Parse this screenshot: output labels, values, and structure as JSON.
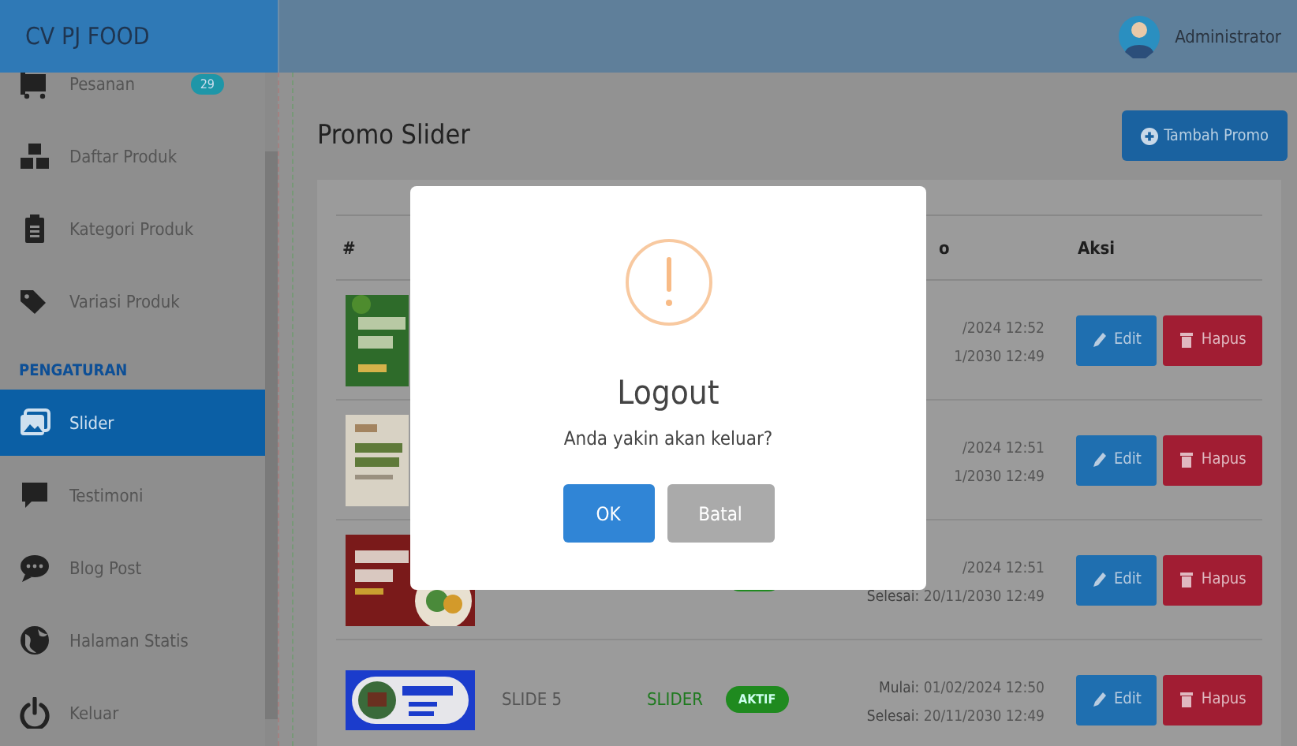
{
  "header": {
    "brand": "CV PJ FOOD",
    "user": "Administrator"
  },
  "sidebar": {
    "items": [
      {
        "kind": "link",
        "label": "Pesanan",
        "badge": "29",
        "selected": false
      },
      {
        "kind": "link",
        "label": "Daftar Produk",
        "selected": false
      },
      {
        "kind": "link",
        "label": "Kategori Produk",
        "selected": false
      },
      {
        "kind": "link",
        "label": "Variasi Produk",
        "selected": false
      },
      {
        "kind": "section",
        "label": "PENGATURAN"
      },
      {
        "kind": "link",
        "label": "Slider",
        "selected": true
      },
      {
        "kind": "link",
        "label": "Testimoni",
        "selected": false
      },
      {
        "kind": "link",
        "label": "Blog Post",
        "selected": false
      },
      {
        "kind": "link",
        "label": "Halaman Statis",
        "selected": false
      },
      {
        "kind": "link",
        "label": "Keluar",
        "selected": false
      }
    ]
  },
  "page": {
    "title": "Promo Slider",
    "add_button": "Tambah Promo"
  },
  "table": {
    "columns": [
      "#",
      "o",
      "Aksi"
    ],
    "rows": [
      {
        "thumb": {
          "kind": "picture"
        },
        "start": "/2024 12:52",
        "end": "1/2030 12:49",
        "actions": [
          "Edit",
          "Hapus"
        ]
      },
      {
        "thumb": {
          "kind": "picture"
        },
        "start": "/2024 12:51",
        "end": "1/2030 12:49",
        "actions": [
          "Edit",
          "Hapus"
        ]
      },
      {
        "thumb": {
          "kind": "picture"
        },
        "status": {
          "kind": "active"
        },
        "start": "/2024 12:51",
        "end": "**Selesai:** 20/11/2030 12:49",
        "actions": [
          "Edit",
          "Hapus"
        ]
      },
      {
        "thumb": {
          "kind": "picture"
        },
        "name": "SLIDE 5",
        "type": "SLIDER",
        "status": {
          "kind": "active",
          "label": "AKTIF"
        },
        "start": "**Mulai:** 01/02/2024 12:50",
        "end": "**Selesai:** 20/11/2030 12:49",
        "actions": [
          "Edit",
          "Hapus"
        ]
      }
    ]
  },
  "modal": {
    "title": "Logout",
    "message": "Anda yakin akan keluar?",
    "buttons": [
      {
        "label": "OK",
        "kind": "confirm"
      },
      {
        "label": "Batal",
        "kind": "cancel"
      }
    ]
  }
}
